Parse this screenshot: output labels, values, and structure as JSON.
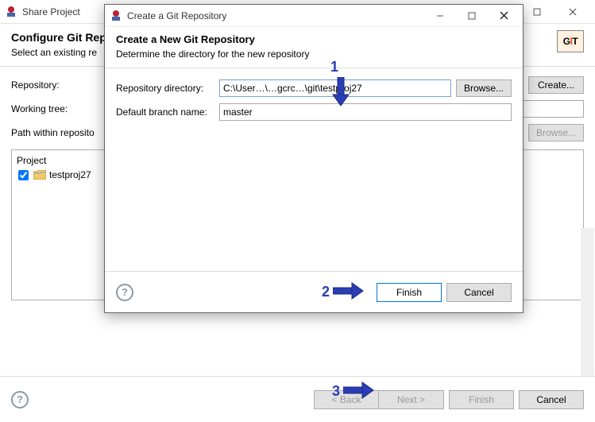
{
  "outer": {
    "title": "Share Project",
    "heading": "Configure Git Rep",
    "sub": "Select an existing re",
    "labels": {
      "repository": "Repository:",
      "workingTree": "Working tree:",
      "pathWithin": "Path within reposito"
    },
    "buttons": {
      "create": "Create...",
      "browse": "Browse...",
      "back": "< Back",
      "next": "Next >",
      "finish": "Finish",
      "cancel": "Cancel"
    },
    "project": {
      "header": "Project",
      "item": "testproj27"
    }
  },
  "inner": {
    "title": "Create a Git Repository",
    "heading": "Create a New Git Repository",
    "sub": "Determine the directory for the new repository",
    "labels": {
      "dir": "Repository directory:",
      "branch": "Default branch name:"
    },
    "values": {
      "dir": "C:\\User…\\…gcrc…\\git\\testproj27",
      "branch": "master"
    },
    "buttons": {
      "browse": "Browse...",
      "finish": "Finish",
      "cancel": "Cancel"
    }
  },
  "git_badge": "GIT",
  "annot": {
    "n1": "1",
    "n2": "2",
    "n3": "3"
  }
}
